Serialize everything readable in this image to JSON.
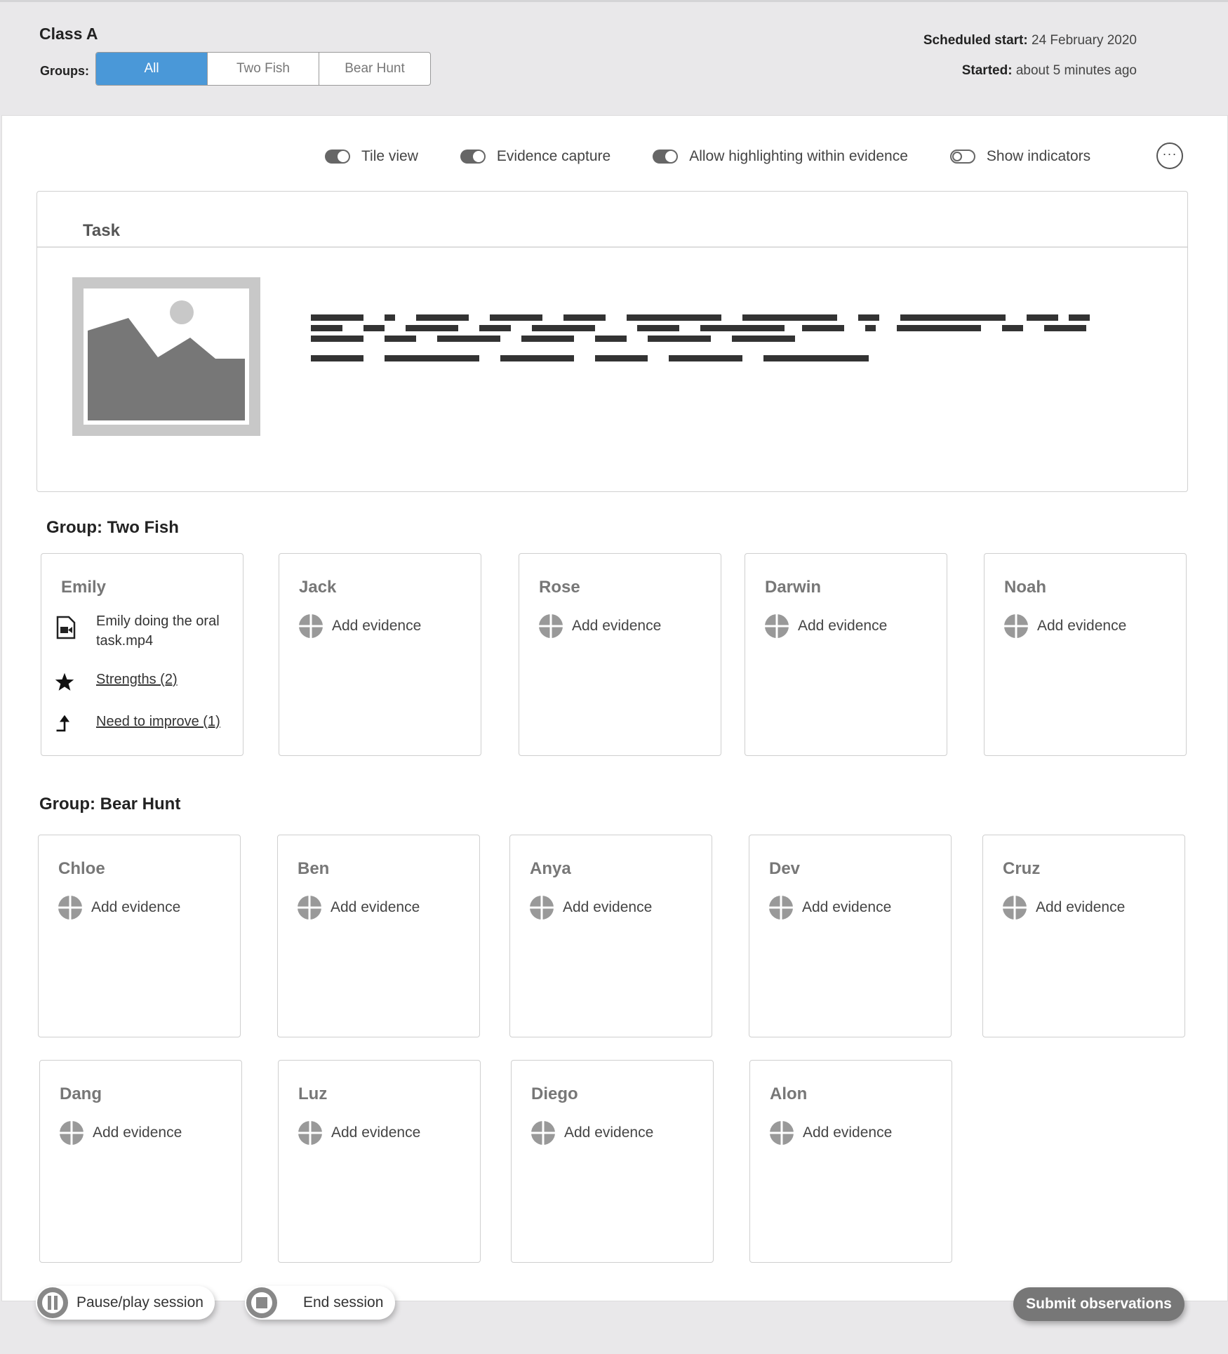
{
  "header": {
    "class_title": "Class A",
    "groups_label": "Groups:",
    "segments": [
      "All",
      "Two Fish",
      "Bear Hunt"
    ],
    "active_segment": "All",
    "scheduled_label": "Scheduled start:",
    "scheduled_value": "24 February 2020",
    "started_label": "Started:",
    "started_value": "about 5 minutes ago"
  },
  "toolbar": {
    "toggles": [
      {
        "label": "Tile view",
        "on": true
      },
      {
        "label": "Evidence capture",
        "on": true
      },
      {
        "label": "Allow highlighting within evidence",
        "on": true
      },
      {
        "label": "Show indicators",
        "on": false
      }
    ],
    "more_label": "···"
  },
  "task": {
    "title": "Task"
  },
  "groups": [
    {
      "title": "Group: Two Fish",
      "students": [
        {
          "name": "Emily",
          "evidence_file": "Emily doing the oral task.mp4",
          "strengths": "Strengths (2)",
          "improve": "Need to improve (1)"
        },
        {
          "name": "Jack",
          "add": "Add evidence"
        },
        {
          "name": "Rose",
          "add": "Add evidence"
        },
        {
          "name": "Darwin",
          "add": "Add evidence"
        },
        {
          "name": "Noah",
          "add": "Add evidence"
        }
      ]
    },
    {
      "title": "Group: Bear Hunt",
      "students": [
        {
          "name": "Chloe",
          "add": "Add evidence"
        },
        {
          "name": "Ben",
          "add": "Add evidence"
        },
        {
          "name": "Anya",
          "add": "Add evidence"
        },
        {
          "name": "Dev",
          "add": "Add evidence"
        },
        {
          "name": "Cruz",
          "add": "Add evidence"
        },
        {
          "name": "Dang",
          "add": "Add evidence"
        },
        {
          "name": "Luz",
          "add": "Add evidence"
        },
        {
          "name": "Diego",
          "add": "Add evidence"
        },
        {
          "name": "Alon",
          "add": "Add evidence"
        }
      ]
    }
  ],
  "footer": {
    "pause_label": "Pause/play session",
    "end_label": "End session",
    "submit_label": "Submit observations"
  }
}
